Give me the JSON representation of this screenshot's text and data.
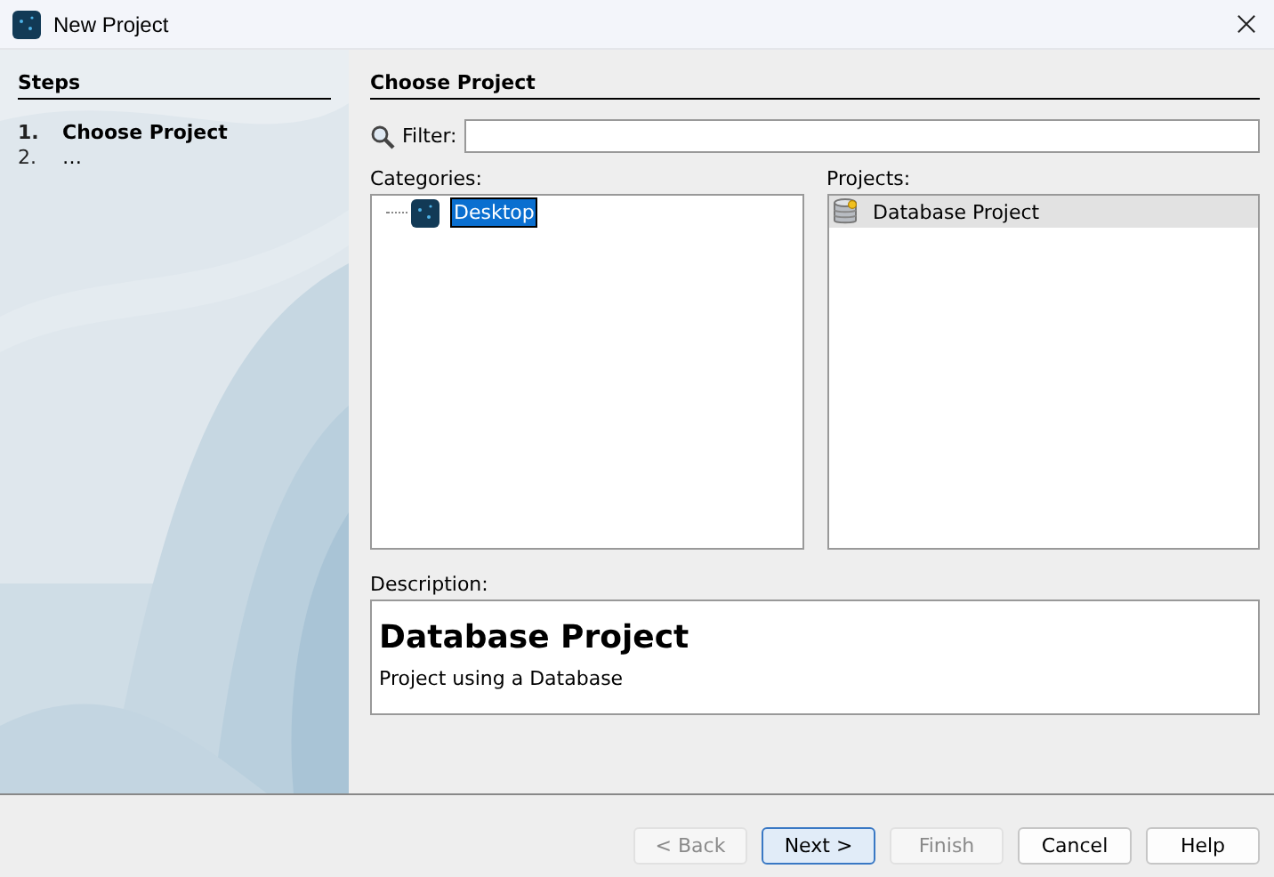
{
  "window": {
    "title": "New Project"
  },
  "steps": {
    "title": "Steps",
    "items": [
      {
        "number": "1.",
        "label": "Choose Project",
        "selected": true
      },
      {
        "number": "2.",
        "label": "…",
        "selected": false
      }
    ]
  },
  "panel": {
    "title": "Choose Project",
    "filter": {
      "label": "Filter:"
    },
    "categories": {
      "label": "Categories:",
      "items": [
        {
          "label": "Desktop",
          "selected": true
        }
      ]
    },
    "projects": {
      "label": "Projects:",
      "items": [
        {
          "label": "Database Project",
          "selected": true
        }
      ]
    },
    "description": {
      "label": "Description:",
      "title": "Database Project",
      "text": "Project using a Database"
    }
  },
  "buttons": [
    {
      "label": "< Back",
      "disabled": true,
      "default": false
    },
    {
      "label": "Next >",
      "disabled": false,
      "default": true
    },
    {
      "label": "Finish",
      "disabled": true,
      "default": false
    },
    {
      "label": "Cancel",
      "disabled": false,
      "default": false
    },
    {
      "label": "Help",
      "disabled": false,
      "default": false
    }
  ]
}
